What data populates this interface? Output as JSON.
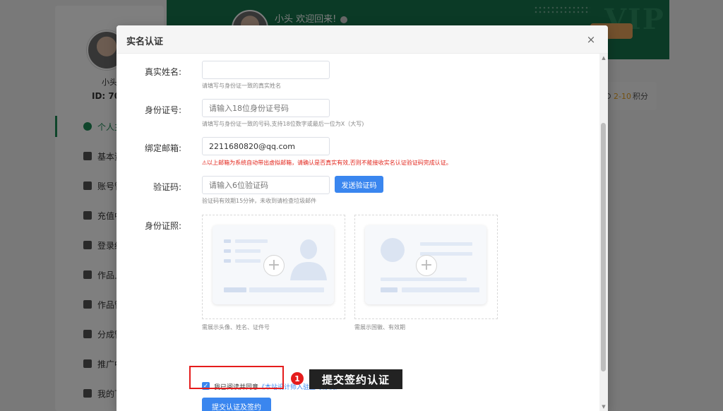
{
  "background": {
    "sidebar": {
      "username": "小头",
      "user_id": "ID: 70",
      "menu": [
        {
          "label": "个人主",
          "active": true
        },
        {
          "label": "基本资"
        },
        {
          "label": "账号管"
        },
        {
          "label": "充值中"
        },
        {
          "label": "登录纪"
        },
        {
          "label": "作品上"
        },
        {
          "label": "作品管"
        },
        {
          "label": "分成管"
        },
        {
          "label": "推广中"
        },
        {
          "label": "我的下"
        }
      ]
    },
    "banner": {
      "greeting": "小头 欢迎回来!",
      "vip_text": "VIP"
    },
    "points_card": {
      "prefix": "2-10",
      "suffix": "积分"
    }
  },
  "modal": {
    "title": "实名认证",
    "close_icon": "×",
    "fields": {
      "real_name": {
        "label": "真实姓名:",
        "value": "",
        "placeholder": "",
        "hint": "请填写与身份证一致的真实姓名"
      },
      "id_number": {
        "label": "身份证号:",
        "value": "",
        "placeholder": "请输入18位身份证号码",
        "hint": "请填写与身份证一致的号码,支持18位数字或最后一位为X（大写)"
      },
      "email": {
        "label": "绑定邮箱:",
        "value": "2211680820@qq.com",
        "placeholder": "",
        "warning": "⚠以上邮箱为系统自动带出虚拟邮箱，请确认是否真实有效,否则不能接收实名认证验证码完成认证。"
      },
      "code": {
        "label": "验证码:",
        "value": "",
        "placeholder": "请输入6位验证码",
        "send_button": "发送验证码",
        "hint": "验证码有效期15分钟，未收到请检查垃圾邮件"
      },
      "id_photo": {
        "label": "身份证照:",
        "front_hint": "需展示头像、姓名、证件号",
        "back_hint": "需展示国徽、有效期"
      }
    },
    "agreement": {
      "checked": true,
      "text": "我已阅读并同意",
      "link": "《本站设计师入驻签约协议》"
    },
    "submit_button": "提交认证及签约"
  },
  "annotation": {
    "number": "1",
    "label": "提交签约认证"
  },
  "colors": {
    "primary": "#3a86ef",
    "brand_green": "#17744c",
    "warning_red": "#e2231a",
    "annotation_red": "#e51c1c"
  }
}
